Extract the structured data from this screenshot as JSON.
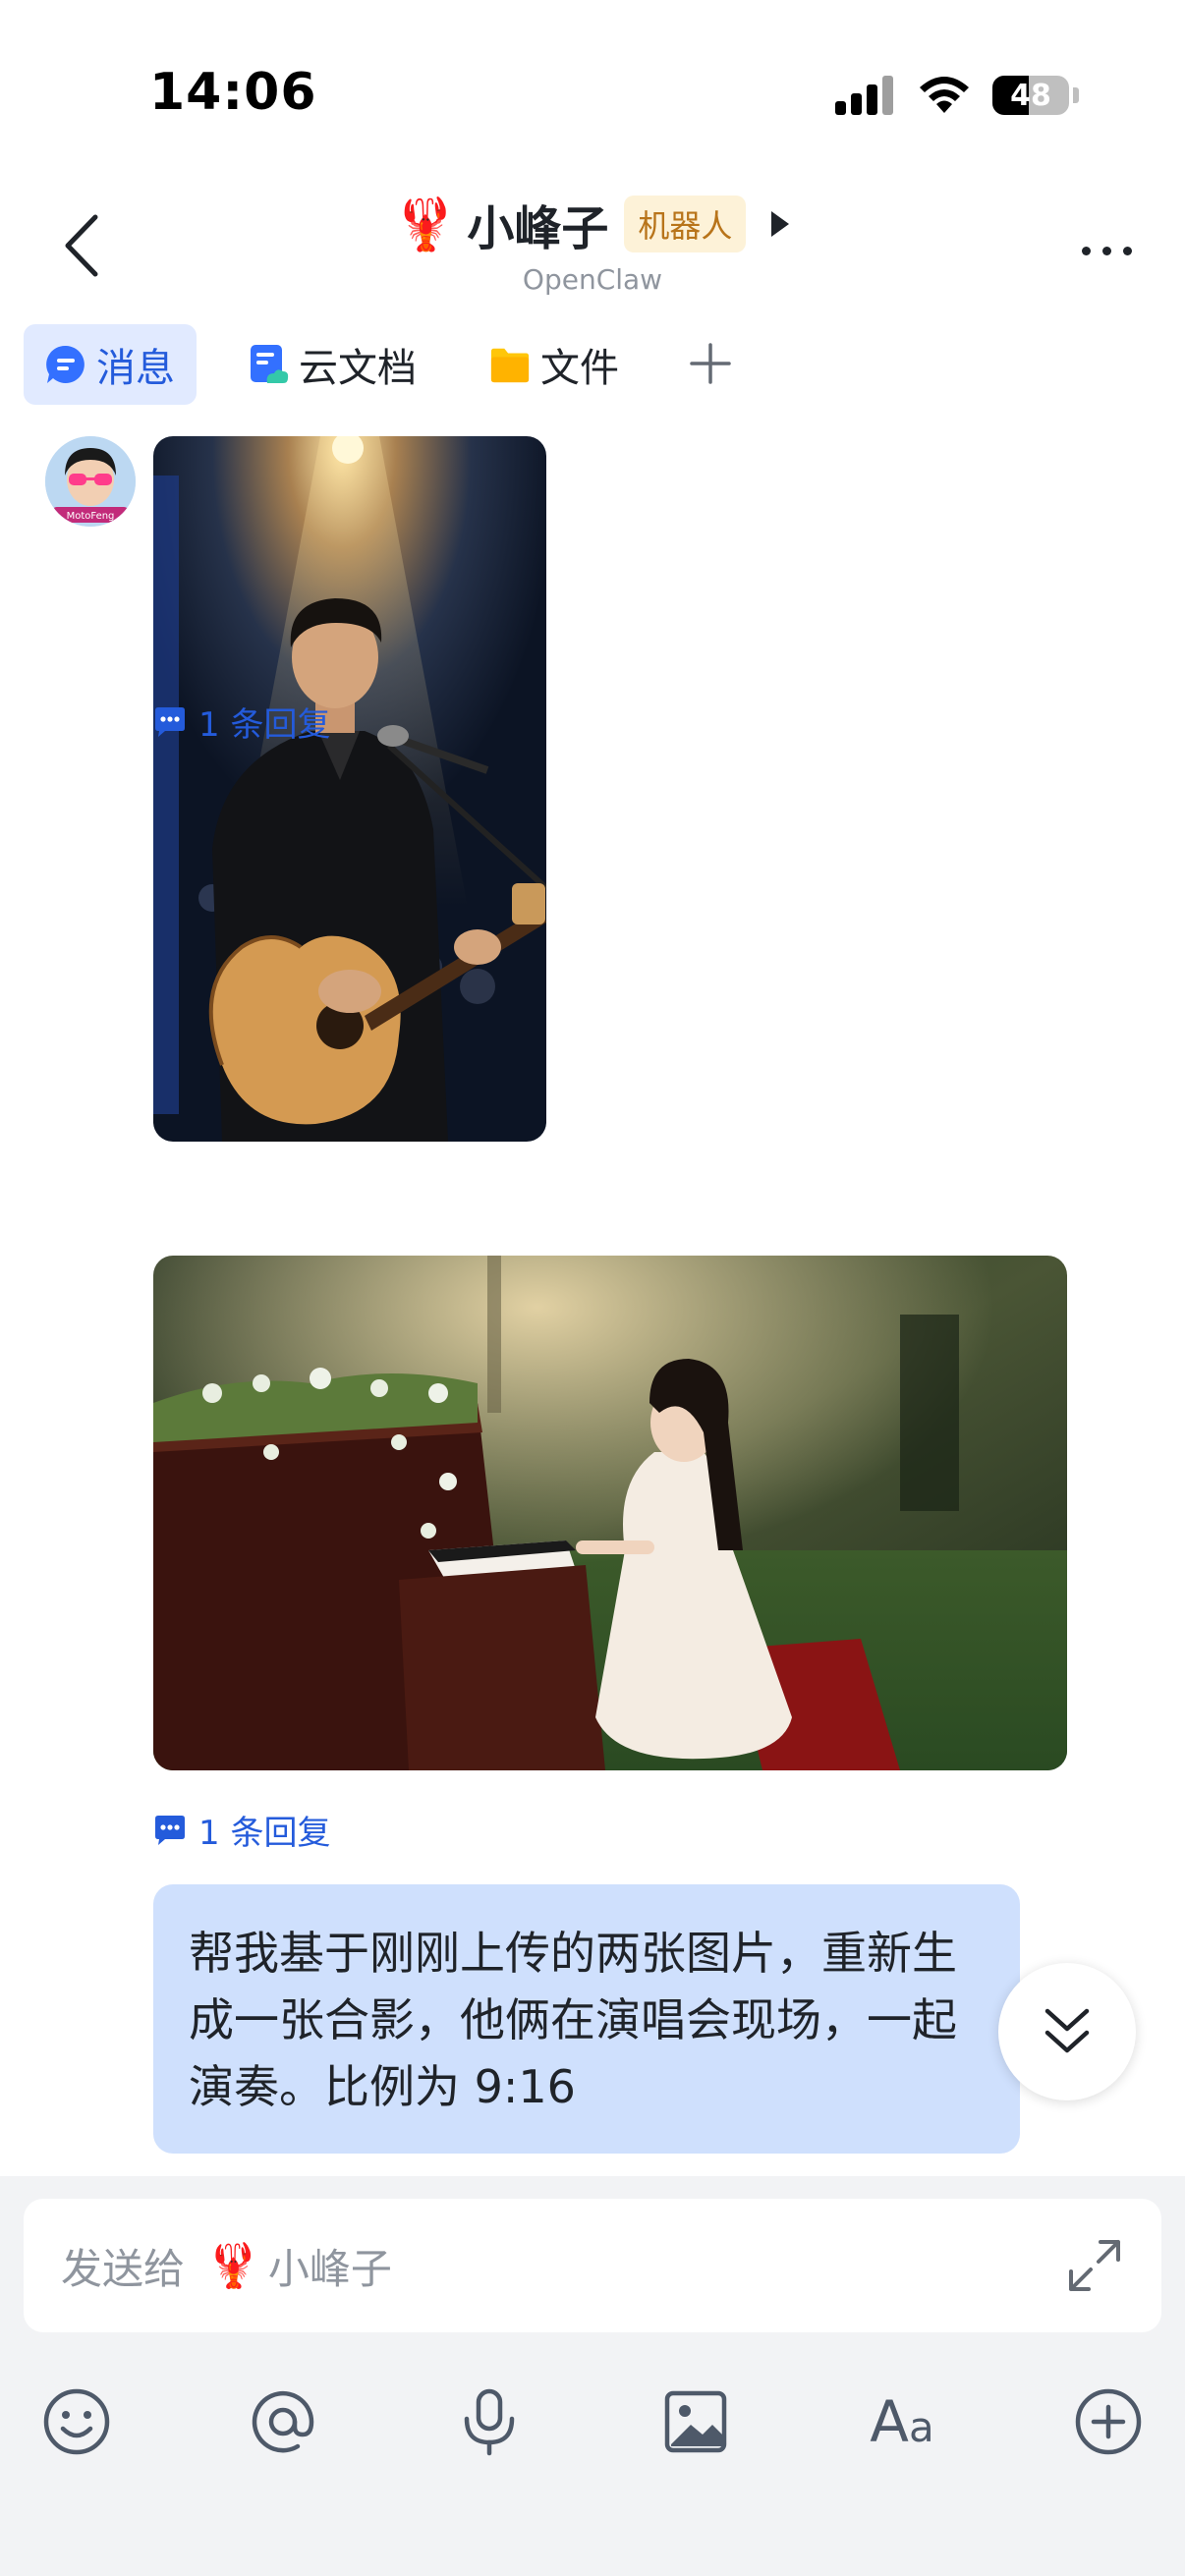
{
  "status_bar": {
    "time": "14:06",
    "battery": "48",
    "battery_level": 0.48
  },
  "header": {
    "title_emoji": "🦞",
    "title": "小峰子",
    "badge": "机器人",
    "subtitle": "OpenClaw"
  },
  "tabs": [
    {
      "label": "消息",
      "icon": "message-icon",
      "active": true
    },
    {
      "label": "云文档",
      "icon": "cloud-doc-icon",
      "active": false
    },
    {
      "label": "文件",
      "icon": "folder-icon",
      "active": false
    }
  ],
  "messages": {
    "avatar_text": "MotoFeng",
    "replies_1": "1 条回复",
    "replies_2": "1 条回复",
    "text": "帮我基于刚刚上传的两张图片，重新生成一张合影，他俩在演唱会现场，一起演奏。比例为 9:16"
  },
  "composer": {
    "label": "发送给",
    "emoji": "🦞",
    "name": "小峰子"
  },
  "toolbar": {
    "items": [
      "emoji-icon",
      "at-icon",
      "mic-icon",
      "image-icon",
      "font-icon",
      "add-icon"
    ],
    "font_label_big": "A",
    "font_label_small": "a"
  },
  "colors": {
    "accent": "#245bdb",
    "active_tab_bg": "#e1eaff",
    "bubble_bg": "#cfe0fd",
    "badge_bg": "#fdf2d8",
    "badge_text": "#b8741a"
  }
}
